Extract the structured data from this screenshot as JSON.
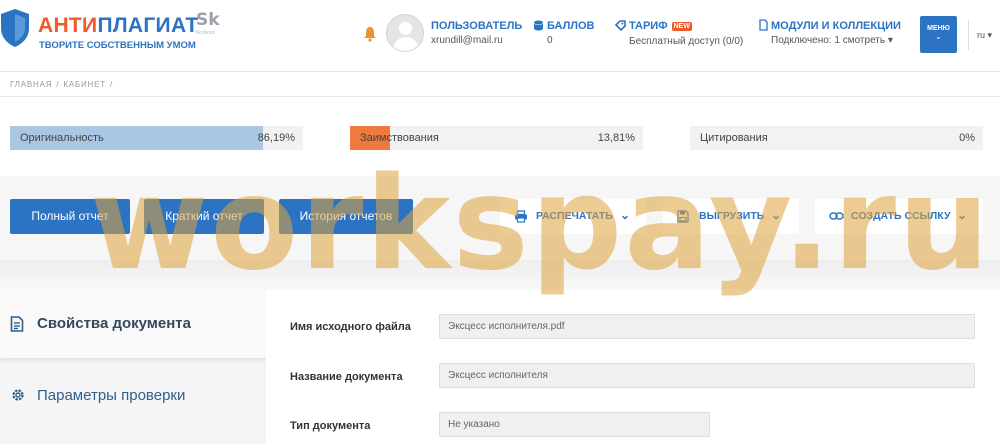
{
  "header": {
    "logo_title_accent": "АНТИ",
    "logo_title_rest": "ПЛАГИАТ",
    "logo_subtitle": "ТВОРИТЕ СОБСТВЕННЫМ УМОМ",
    "sk_logo": "Sk",
    "sk_sub": "Skolkovo",
    "user_label": "Пользователь",
    "user_email": "xrundill@mail.ru",
    "points_label": "Баллов",
    "points_value": "0",
    "tariff_label": "Тариф",
    "tariff_badge": "NEW",
    "tariff_value": "Бесплатный доступ (0/0)",
    "modules_label": "Модули и коллекции",
    "modules_value": "Подключено: 1 смотреть",
    "menu_label": "Меню",
    "lang": "ru"
  },
  "breadcrumb": [
    "Главная",
    "Кабинет"
  ],
  "stats": [
    {
      "name": "Оригинальность",
      "value": "86,19%",
      "percent": 86.19,
      "color": "#a9c6e3"
    },
    {
      "name": "Заимствования",
      "value": "13,81%",
      "percent": 13.81,
      "color": "#f07a3e"
    },
    {
      "name": "Цитирования",
      "value": "0%",
      "percent": 0,
      "color": "#cfcfcf"
    }
  ],
  "actions": {
    "full_report": "Полный отчет",
    "short_report": "Краткий отчет",
    "history": "История отчетов",
    "print": "Распечатать",
    "export": "Выгрузить",
    "create_link": "Создать ссылку"
  },
  "sidebar": {
    "items": [
      {
        "label": "Свойства документа",
        "icon": "document-icon",
        "active": true
      },
      {
        "label": "Параметры проверки",
        "icon": "gear-icon",
        "active": false
      }
    ]
  },
  "form": {
    "fields": [
      {
        "label": "Имя исходного файла",
        "value": "Эксцесс исполнителя.pdf"
      },
      {
        "label": "Название документа",
        "value": "Эксцесс исполнителя"
      },
      {
        "label": "Тип документа",
        "value": "Не указано"
      }
    ]
  },
  "watermark": "workspay.ru",
  "colors": {
    "brand_blue": "#2d73c4",
    "brand_orange": "#f05a28"
  }
}
